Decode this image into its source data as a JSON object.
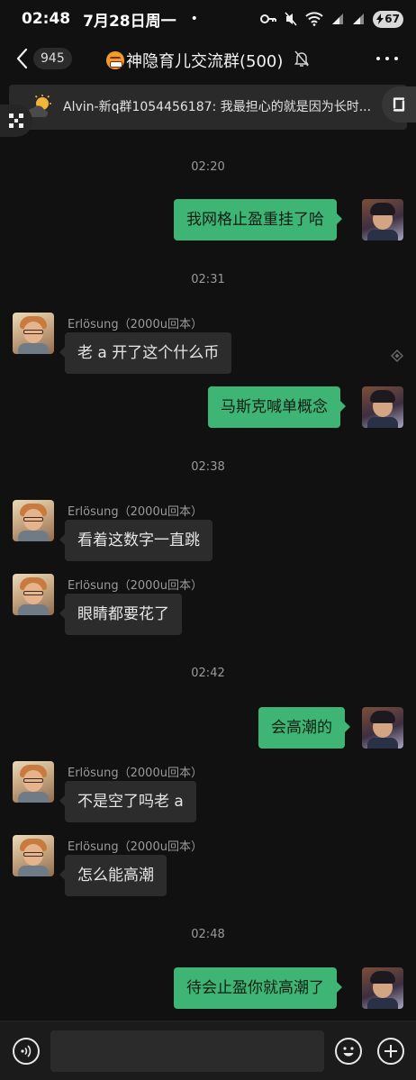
{
  "status_bar": {
    "time": "02:48",
    "date": "7月28日周一",
    "dot": "•",
    "battery": "67"
  },
  "header": {
    "unread_count": "945",
    "title": "神隐育儿交流群(500)",
    "title_emoji_icon": "grimacing-face-emoji",
    "back_icon": "chevron-left-icon",
    "mute_icon": "bell-slash-icon",
    "more_icon": "more-dots-icon"
  },
  "pinned": {
    "icon": "sun-cloud-icon",
    "text": "Alvin-新q群1054456187: 我最担心的就是因为长时..."
  },
  "messages": [
    {
      "type": "time",
      "text": "02:20"
    },
    {
      "type": "self",
      "text": "我网格止盈重挂了哈"
    },
    {
      "type": "time",
      "text": "02:31"
    },
    {
      "type": "other",
      "sender": "Erlösung（2000u回本）",
      "text": "老 a 开了这个什么币"
    },
    {
      "type": "self",
      "text": "马斯克喊单概念"
    },
    {
      "type": "time",
      "text": "02:38"
    },
    {
      "type": "other",
      "sender": "Erlösung（2000u回本）",
      "text": "看着这数字一直跳"
    },
    {
      "type": "other",
      "sender": "Erlösung（2000u回本）",
      "text": "眼睛都要花了"
    },
    {
      "type": "time",
      "text": "02:42"
    },
    {
      "type": "self",
      "text": "会高潮的"
    },
    {
      "type": "other",
      "sender": "Erlösung（2000u回本）",
      "text": "不是空了吗老 a"
    },
    {
      "type": "other",
      "sender": "Erlösung（2000u回本）",
      "text": "怎么能高潮"
    },
    {
      "type": "time",
      "text": "02:48"
    },
    {
      "type": "self",
      "text": "待会止盈你就高潮了"
    }
  ],
  "input_bar": {
    "voice_icon": "voice-icon",
    "emoji_icon": "smiley-icon",
    "plus_icon": "plus-icon",
    "input_value": ""
  },
  "colors": {
    "background": "#111111",
    "self_bubble": "#3eb575",
    "other_bubble": "#2c2c2c"
  }
}
